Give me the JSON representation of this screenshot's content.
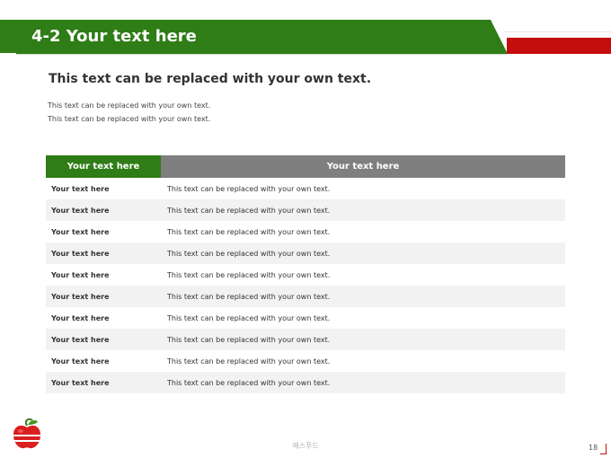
{
  "header": {
    "title": "4-2 Your text here",
    "accent_color": "#2e7d16",
    "red_accent": "#c40d0d"
  },
  "subtitle": "This text can be replaced with your own text.",
  "body_lines": [
    "This text can be replaced with your own text.",
    "This text can be replaced with your own text."
  ],
  "table": {
    "headers": [
      "Your text here",
      "Your text here"
    ],
    "rows": [
      [
        "Your text here",
        "This text can be replaced with your own text."
      ],
      [
        "Your text here",
        "This text can be replaced with your own text."
      ],
      [
        "Your text here",
        "This text can be replaced with your own text."
      ],
      [
        "Your text here",
        "This text can be replaced with your own text."
      ],
      [
        "Your text here",
        "This text can be replaced with your own text."
      ],
      [
        "Your text here",
        "This text can be replaced with your own text."
      ],
      [
        "Your text here",
        "This text can be replaced with your own text."
      ],
      [
        "Your text here",
        "This text can be replaced with your own text."
      ],
      [
        "Your text here",
        "This text can be replaced with your own text."
      ],
      [
        "Your text here",
        "This text can be replaced with your own text."
      ]
    ]
  },
  "footer": {
    "center_text": "애스푸드",
    "page_number": "18",
    "logo_icon": "apple-icon"
  }
}
